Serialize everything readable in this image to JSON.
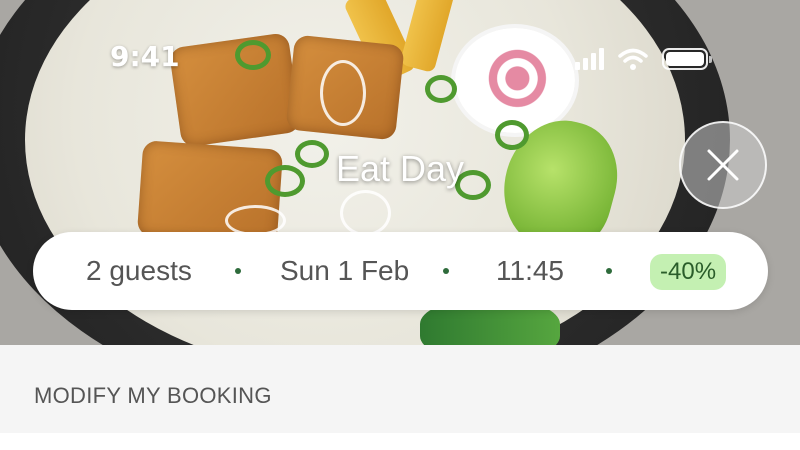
{
  "status_bar": {
    "time": "9:41",
    "icons": [
      "cellular-signal-icon",
      "wifi-icon",
      "battery-icon"
    ]
  },
  "venue": {
    "name": "Eat Day",
    "hero_image": "ramen-bowl-photo"
  },
  "close_button": {
    "icon": "close-icon"
  },
  "booking_summary": {
    "guests": "2 guests",
    "date": "Sun 1 Feb",
    "time": "11:45",
    "discount": "-40%"
  },
  "section": {
    "label": "MODIFY MY BOOKING"
  },
  "colors": {
    "discount_bg": "#c4f0b2",
    "discount_text": "#2a5d2a",
    "separator_dot": "#2e6b3b",
    "section_bg": "#f5f5f5"
  }
}
